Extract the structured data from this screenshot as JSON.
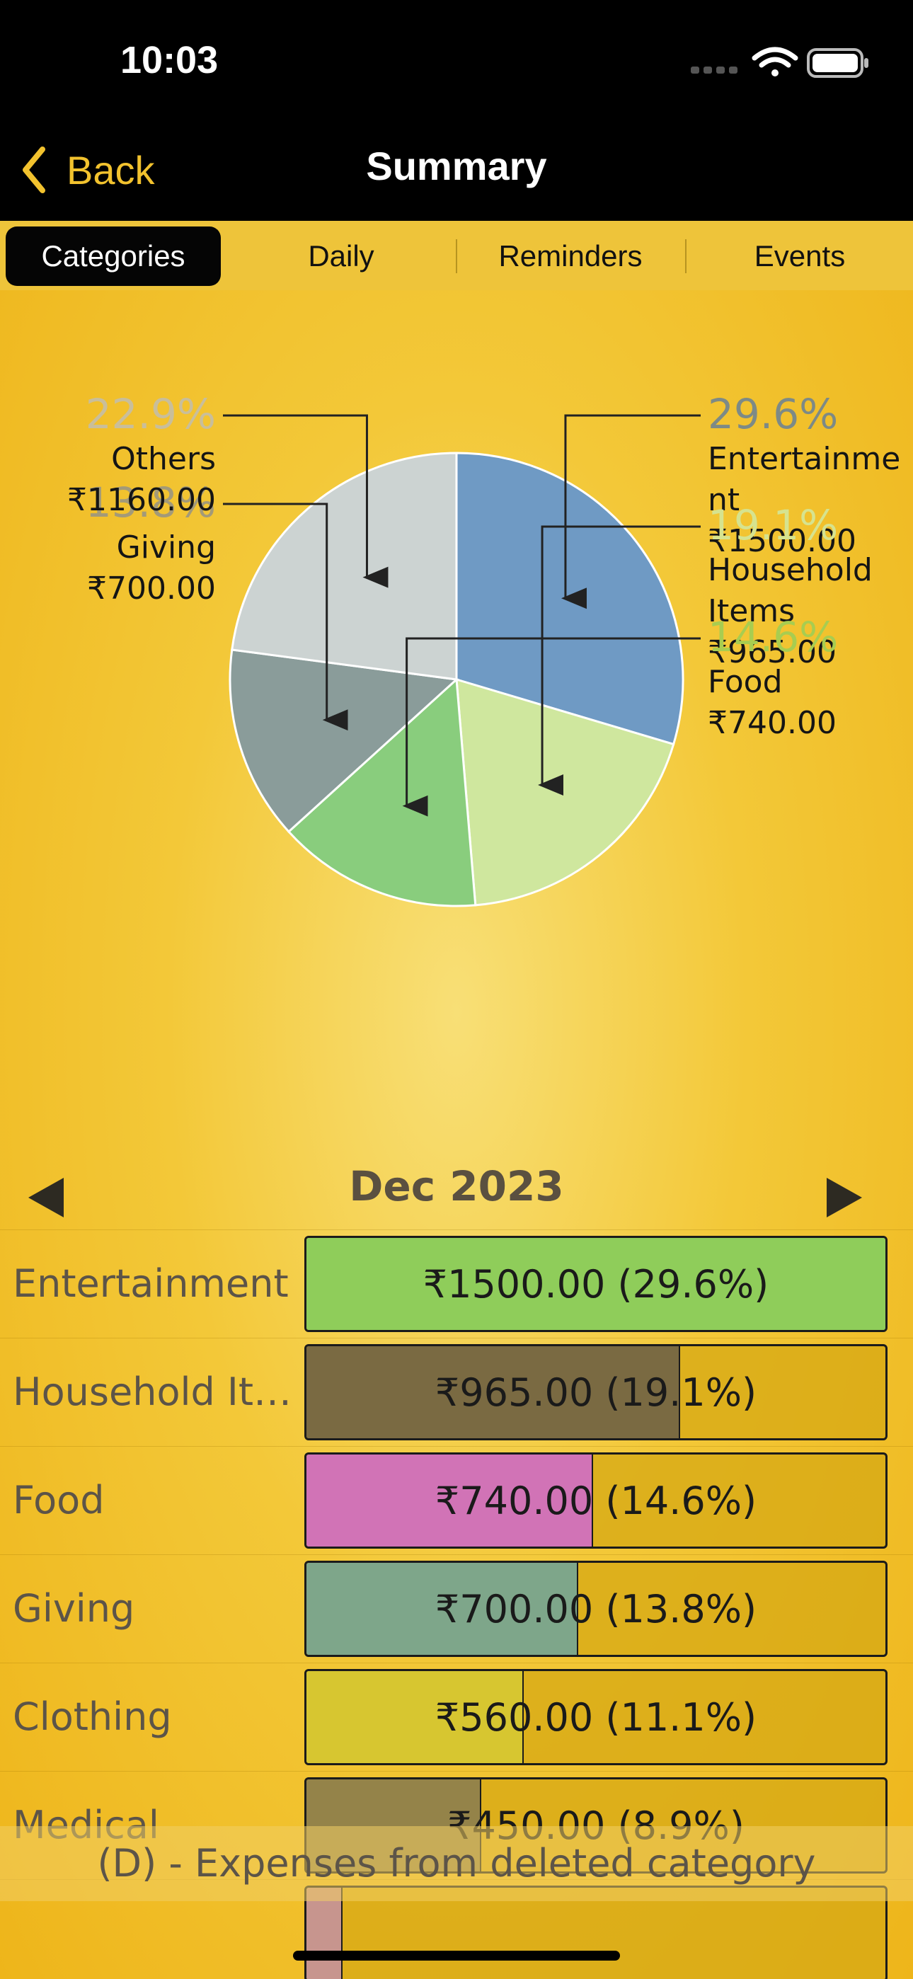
{
  "status": {
    "time": "10:03"
  },
  "nav": {
    "back_label": "Back",
    "title": "Summary"
  },
  "tabs": [
    {
      "label": "Categories",
      "active": true
    },
    {
      "label": "Daily",
      "active": false
    },
    {
      "label": "Reminders",
      "active": false
    },
    {
      "label": "Events",
      "active": false
    }
  ],
  "chart_data": {
    "type": "pie",
    "slices": [
      {
        "name": "Entertainment",
        "label_lines": [
          "Entertainme",
          "nt"
        ],
        "percent": "29.6%",
        "amount": "₹1500.00",
        "value": 1500,
        "color": "#6f9ac4",
        "pct_color": "#7d8a86"
      },
      {
        "name": "Household Items",
        "label_lines": [
          "Household",
          "Items"
        ],
        "percent": "19.1%",
        "amount": "₹965.00",
        "value": 965,
        "color": "#cfe79e",
        "pct_color": "#d6e38f"
      },
      {
        "name": "Food",
        "label_lines": [
          "Food"
        ],
        "percent": "14.6%",
        "amount": "₹740.00",
        "value": 740,
        "color": "#89cd7d",
        "pct_color": "#a8cd50"
      },
      {
        "name": "Giving",
        "label_lines": [
          "Giving"
        ],
        "percent": "13.8%",
        "amount": "₹700.00",
        "value": 700,
        "color": "#8a9c9a",
        "pct_color": "#a39a78"
      },
      {
        "name": "Others",
        "label_lines": [
          "Others"
        ],
        "percent": "22.9%",
        "amount": "₹1160.00",
        "value": 1160,
        "color": "#ccd3d2",
        "pct_color": "#c9be9a"
      }
    ]
  },
  "period": {
    "month": "Dec 2023"
  },
  "breakdown": [
    {
      "label": "Entertainment",
      "text": "₹1500.00 (29.6%)",
      "fraction": 1.0,
      "color": "#8fcd5a"
    },
    {
      "label": "Household It…",
      "text": "₹965.00 (19.1%)",
      "fraction": 0.643,
      "color": "#7a6a42"
    },
    {
      "label": "Food",
      "text": "₹740.00 (14.6%)",
      "fraction": 0.493,
      "color": "#d173b6"
    },
    {
      "label": "Giving",
      "text": "₹700.00 (13.8%)",
      "fraction": 0.467,
      "color": "#7ea68a"
    },
    {
      "label": "Clothing",
      "text": "₹560.00 (11.1%)",
      "fraction": 0.373,
      "color": "#d7c630"
    },
    {
      "label": "Medical",
      "text": "₹450.00 (8.9%)",
      "fraction": 0.3,
      "color": "#948349"
    },
    {
      "label": "",
      "text": "",
      "fraction": 0.06,
      "color": "#c7958e"
    }
  ],
  "footer": {
    "note": "(D) - Expenses from deleted category"
  }
}
